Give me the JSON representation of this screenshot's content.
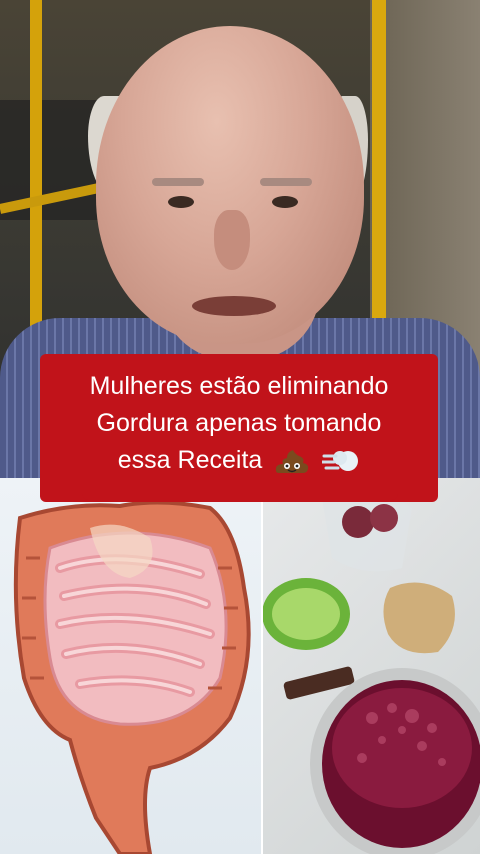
{
  "caption": {
    "line1": "Mulheres estão eliminando",
    "line2": "Gordura apenas tomando",
    "line3": "essa Receita"
  },
  "icons": [
    "poop-emoji-icon",
    "wind-dash-icon"
  ],
  "colors": {
    "caption_bg": "#c1131a",
    "caption_text": "#ffffff"
  }
}
